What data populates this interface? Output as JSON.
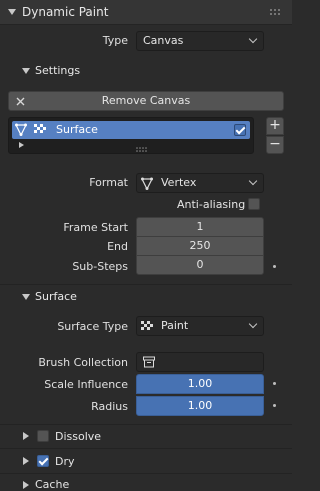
{
  "panel": {
    "title": "Dynamic Paint"
  },
  "type_row": {
    "label": "Type",
    "value": "Canvas"
  },
  "settings": {
    "title": "Settings",
    "remove_button": "Remove Canvas",
    "surface_item": "Surface",
    "add_symbol": "+",
    "remove_symbol": "−"
  },
  "format_row": {
    "label": "Format",
    "value": "Vertex"
  },
  "anti_aliasing": {
    "label": "Anti-aliasing",
    "checked": false
  },
  "frame_start": {
    "label": "Frame Start",
    "value": "1"
  },
  "end": {
    "label": "End",
    "value": "250"
  },
  "substeps": {
    "label": "Sub-Steps",
    "value": "0"
  },
  "surface": {
    "title": "Surface",
    "type_label": "Surface Type",
    "type_value": "Paint",
    "brush_collection_label": "Brush Collection",
    "scale_influence_label": "Scale Influence",
    "scale_influence_value": "1.00",
    "radius_label": "Radius",
    "radius_value": "1.00"
  },
  "subpanels": {
    "dissolve": {
      "label": "Dissolve",
      "checked": false
    },
    "dry": {
      "label": "Dry",
      "checked": true
    },
    "cache": {
      "label": "Cache"
    }
  },
  "colors": {
    "accent": "#4772b3",
    "selected_item": "#5680c2"
  },
  "icons": [
    "chevron-down-icon",
    "chevron-right-icon",
    "close-icon",
    "vertex-icon",
    "checker-icon",
    "collection-icon",
    "drag-handle-icon"
  ]
}
